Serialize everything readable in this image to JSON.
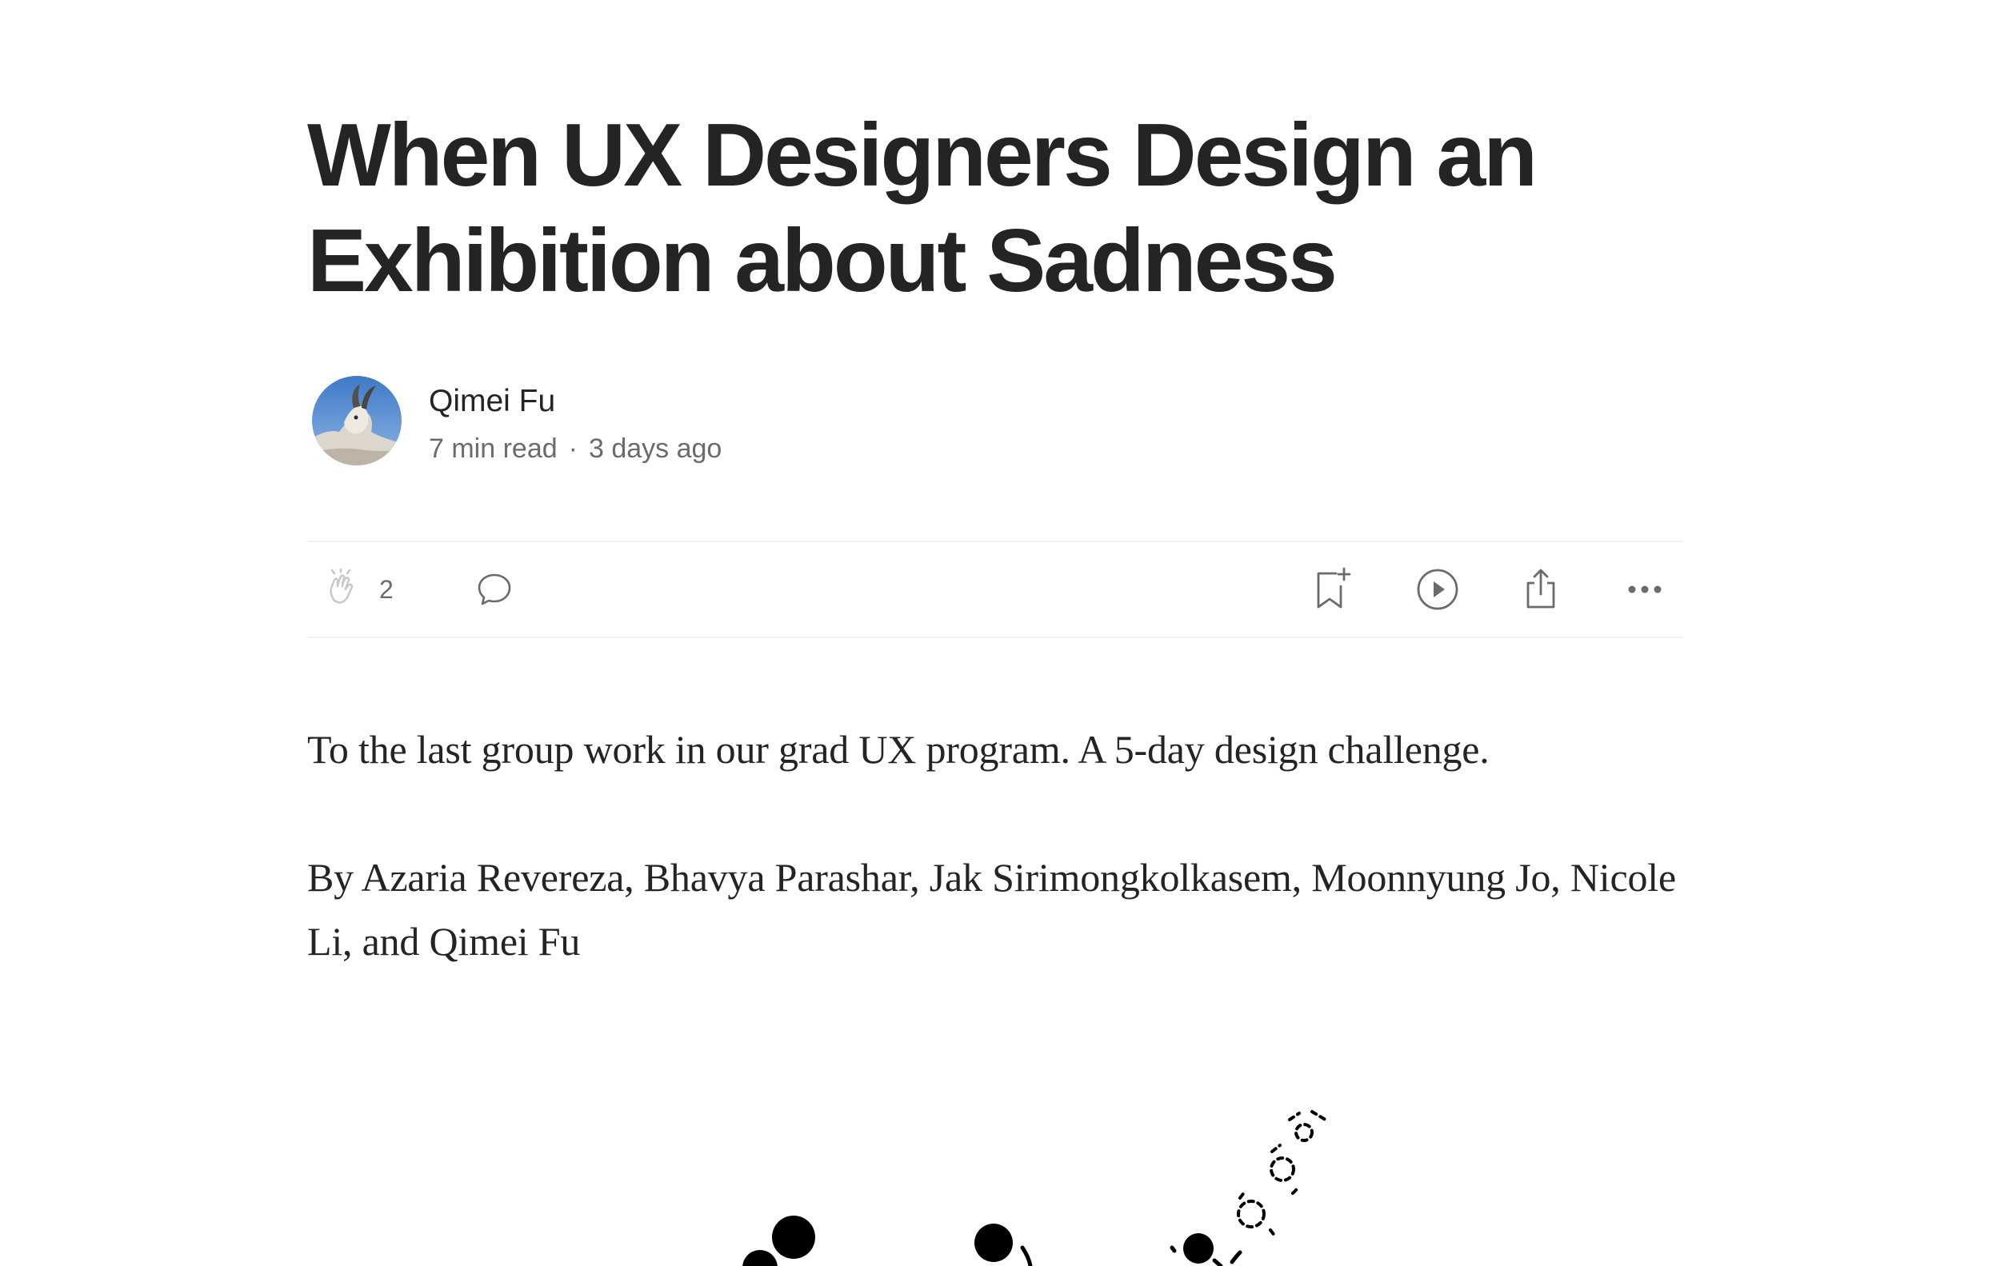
{
  "article": {
    "title": "When UX Designers Design an Exhibition about Sadness",
    "author": {
      "name": "Qimei Fu",
      "avatar_icon": "goat-avatar"
    },
    "read_time": "7 min read",
    "separator": "·",
    "published": "3 days ago"
  },
  "actions": {
    "clap_icon": "clap-icon",
    "clap_count": "2",
    "respond_icon": "speech-bubble-icon",
    "save_icon": "bookmark-add-icon",
    "listen_icon": "play-icon",
    "share_icon": "share-icon",
    "more_icon": "more-dots-icon"
  },
  "body": {
    "paragraph1": "To the last group work in our grad UX program. A 5-day design challenge.",
    "paragraph2": "By Azaria Revereza, Bhavya Parashar, Jak Sirimongkolkasem, Moonnyung Jo, Nicole Li, and Qimei Fu"
  },
  "colors": {
    "text": "#242424",
    "muted": "#6b6b6b",
    "divider": "#f2f2f2"
  }
}
